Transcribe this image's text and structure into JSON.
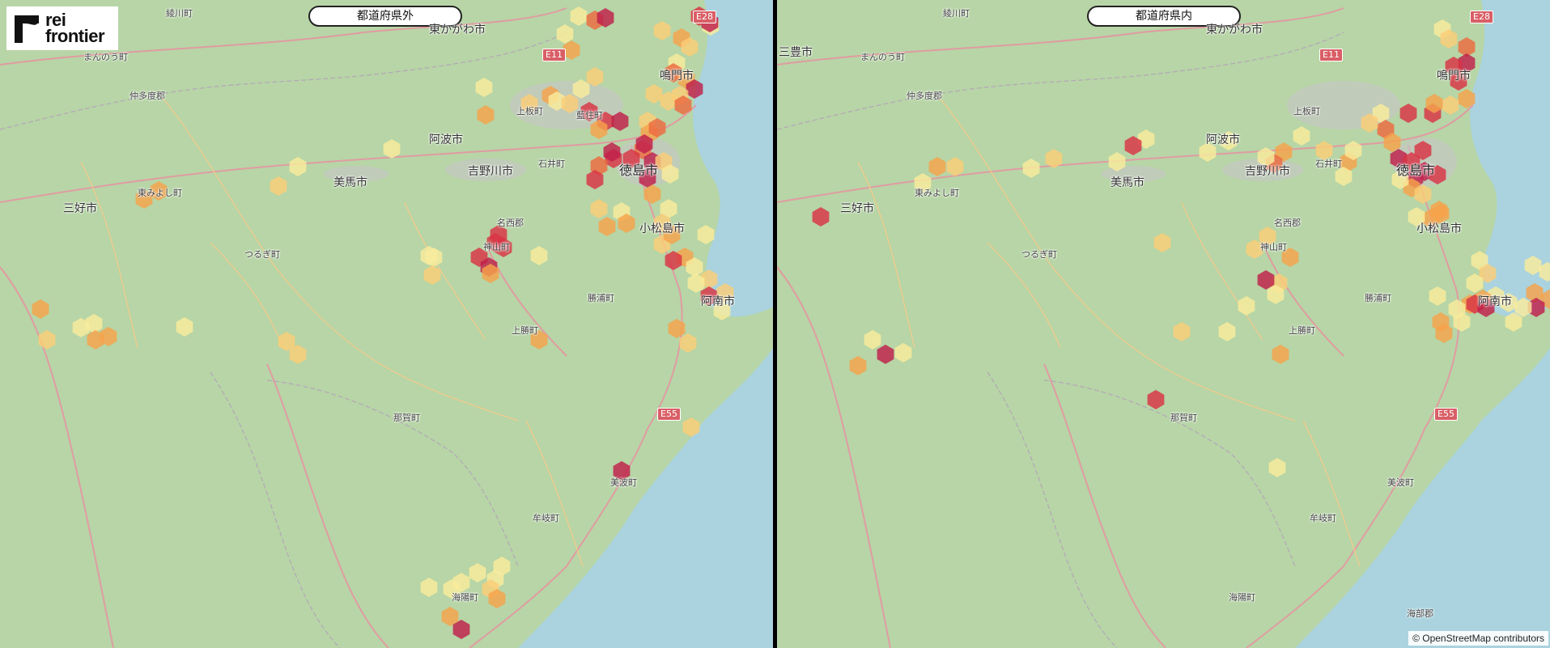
{
  "logo": {
    "line1": "rei",
    "line2": "frontier"
  },
  "attribution": "© OpenStreetMap contributors",
  "colors": {
    "water": "#aad3df",
    "land": "#b7d5a6",
    "road_major": "#e892a2",
    "road_minor": "#f7c98b",
    "bin_low": "#f9ec9c",
    "bin_mid_low": "#fbcd78",
    "bin_mid": "#f6a24b",
    "bin_mid_high": "#ed6a3f",
    "bin_high": "#d93344",
    "bin_top": "#bf1e4b"
  },
  "panels": {
    "left": {
      "title": "都道府県外",
      "labels": [
        "綾川町",
        "東かがわ市",
        "まんのう町",
        "仲多度郡",
        "鳴門市",
        "上板町",
        "藍住町",
        "阿波市",
        "吉野川市",
        "石井町",
        "徳島市",
        "美馬市",
        "東みよし町",
        "三好市",
        "つるぎ町",
        "名西郡",
        "神山町",
        "小松島市",
        "勝浦町",
        "阿南市",
        "上勝町",
        "那賀町",
        "美波町",
        "牟岐町",
        "海陽町",
        "E28",
        "E11",
        "E55"
      ],
      "hex_bins": [
        [
          715,
          20,
          "low"
        ],
        [
          735,
          25,
          "mid_high"
        ],
        [
          748,
          22,
          "top"
        ],
        [
          698,
          42,
          "low"
        ],
        [
          818,
          38,
          "mid_low"
        ],
        [
          842,
          47,
          "mid"
        ],
        [
          852,
          58,
          "mid_low"
        ],
        [
          878,
          32,
          "low"
        ],
        [
          864,
          20,
          "high"
        ],
        [
          877,
          28,
          "top"
        ],
        [
          706,
          62,
          "mid"
        ],
        [
          735,
          95,
          "mid_low"
        ],
        [
          836,
          78,
          "low"
        ],
        [
          832,
          90,
          "mid_high"
        ],
        [
          848,
          98,
          "mid"
        ],
        [
          858,
          110,
          "top"
        ],
        [
          840,
          118,
          "mid_low"
        ],
        [
          826,
          125,
          "mid_low"
        ],
        [
          844,
          130,
          "mid_high"
        ],
        [
          808,
          116,
          "mid_low"
        ],
        [
          728,
          138,
          "high"
        ],
        [
          748,
          150,
          "high"
        ],
        [
          766,
          150,
          "top"
        ],
        [
          740,
          160,
          "mid"
        ],
        [
          680,
          118,
          "mid"
        ],
        [
          688,
          125,
          "low"
        ],
        [
          654,
          128,
          "mid_low"
        ],
        [
          704,
          128,
          "mid_low"
        ],
        [
          718,
          110,
          "low"
        ],
        [
          800,
          150,
          "mid_low"
        ],
        [
          802,
          165,
          "mid"
        ],
        [
          812,
          158,
          "mid_high"
        ],
        [
          794,
          185,
          "mid_high"
        ],
        [
          780,
          196,
          "high"
        ],
        [
          758,
          196,
          "high"
        ],
        [
          740,
          205,
          "mid_high"
        ],
        [
          735,
          222,
          "high"
        ],
        [
          756,
          188,
          "top"
        ],
        [
          796,
          178,
          "top"
        ],
        [
          806,
          200,
          "top"
        ],
        [
          800,
          220,
          "top"
        ],
        [
          820,
          200,
          "mid_low"
        ],
        [
          828,
          215,
          "low"
        ],
        [
          806,
          240,
          "mid"
        ],
        [
          826,
          258,
          "low"
        ],
        [
          818,
          276,
          "mid_low"
        ],
        [
          818,
          302,
          "mid_low"
        ],
        [
          830,
          290,
          "mid"
        ],
        [
          846,
          318,
          "mid"
        ],
        [
          832,
          322,
          "high"
        ],
        [
          858,
          330,
          "low"
        ],
        [
          872,
          290,
          "low"
        ],
        [
          876,
          345,
          "mid_low"
        ],
        [
          860,
          350,
          "low"
        ],
        [
          876,
          366,
          "high"
        ],
        [
          896,
          362,
          "mid_low"
        ],
        [
          892,
          384,
          "low"
        ],
        [
          836,
          406,
          "mid"
        ],
        [
          850,
          424,
          "mid_low"
        ],
        [
          740,
          258,
          "mid_low"
        ],
        [
          768,
          262,
          "low"
        ],
        [
          774,
          276,
          "mid"
        ],
        [
          750,
          280,
          "mid"
        ],
        [
          598,
          108,
          "low"
        ],
        [
          600,
          142,
          "mid"
        ],
        [
          484,
          184,
          "low"
        ],
        [
          368,
          206,
          "low"
        ],
        [
          344,
          230,
          "mid_low"
        ],
        [
          196,
          236,
          "mid"
        ],
        [
          178,
          246,
          "mid"
        ],
        [
          536,
          318,
          "low"
        ],
        [
          534,
          340,
          "mid_low"
        ],
        [
          616,
          290,
          "high"
        ],
        [
          612,
          300,
          "high"
        ],
        [
          592,
          318,
          "high"
        ],
        [
          604,
          330,
          "top"
        ],
        [
          622,
          306,
          "high"
        ],
        [
          606,
          338,
          "mid"
        ],
        [
          666,
          316,
          "low"
        ],
        [
          530,
          316,
          "low"
        ],
        [
          50,
          382,
          "mid"
        ],
        [
          100,
          405,
          "low"
        ],
        [
          116,
          400,
          "low"
        ],
        [
          118,
          420,
          "mid"
        ],
        [
          134,
          416,
          "mid"
        ],
        [
          58,
          420,
          "mid_low"
        ],
        [
          228,
          404,
          "low"
        ],
        [
          354,
          422,
          "mid_low"
        ],
        [
          368,
          438,
          "mid_low"
        ],
        [
          666,
          420,
          "mid"
        ],
        [
          854,
          528,
          "mid_low"
        ],
        [
          768,
          582,
          "top"
        ],
        [
          620,
          700,
          "low"
        ],
        [
          612,
          716,
          "low"
        ],
        [
          590,
          708,
          "low"
        ],
        [
          570,
          720,
          "low"
        ],
        [
          558,
          728,
          "low"
        ],
        [
          530,
          726,
          "low"
        ],
        [
          606,
          728,
          "mid_low"
        ],
        [
          614,
          740,
          "mid"
        ],
        [
          556,
          762,
          "mid"
        ],
        [
          570,
          778,
          "top"
        ]
      ]
    },
    "right": {
      "title": "都道府県内",
      "labels": [
        "綾川町",
        "三豊市",
        "まんのう町",
        "仲多度郡",
        "東かがわ市",
        "鳴門市",
        "上板町",
        "阿波市",
        "吉野川市",
        "石井町",
        "徳島市",
        "美馬市",
        "東みよし町",
        "三好市",
        "つるぎ町",
        "名西郡",
        "神山町",
        "小松島市",
        "勝浦町",
        "阿南市",
        "上勝町",
        "那賀町",
        "美波町",
        "牟岐町",
        "海陽町",
        "海部郡",
        "E28",
        "E11",
        "E55"
      ],
      "hex_bins": [
        [
          822,
          36,
          "low"
        ],
        [
          830,
          48,
          "mid_low"
        ],
        [
          852,
          58,
          "mid_high"
        ],
        [
          852,
          78,
          "top"
        ],
        [
          836,
          82,
          "high"
        ],
        [
          842,
          100,
          "high"
        ],
        [
          852,
          122,
          "mid"
        ],
        [
          832,
          130,
          "mid_low"
        ],
        [
          810,
          140,
          "high"
        ],
        [
          812,
          128,
          "mid"
        ],
        [
          780,
          140,
          "high"
        ],
        [
          746,
          140,
          "low"
        ],
        [
          752,
          160,
          "mid_high"
        ],
        [
          732,
          152,
          "mid_low"
        ],
        [
          760,
          176,
          "mid"
        ],
        [
          768,
          196,
          "top"
        ],
        [
          784,
          200,
          "high"
        ],
        [
          788,
          220,
          "top"
        ],
        [
          800,
          212,
          "top"
        ],
        [
          816,
          216,
          "high"
        ],
        [
          784,
          232,
          "mid"
        ],
        [
          770,
          222,
          "low"
        ],
        [
          798,
          240,
          "mid_low"
        ],
        [
          818,
          260,
          "mid"
        ],
        [
          808,
          270,
          "mid"
        ],
        [
          790,
          268,
          "low"
        ],
        [
          798,
          186,
          "high"
        ],
        [
          706,
          200,
          "mid"
        ],
        [
          712,
          186,
          "low"
        ],
        [
          700,
          218,
          "low"
        ],
        [
          676,
          186,
          "mid_low"
        ],
        [
          648,
          168,
          "low"
        ],
        [
          626,
          188,
          "mid"
        ],
        [
          614,
          202,
          "mid_high"
        ],
        [
          604,
          194,
          "low"
        ],
        [
          558,
          174,
          "low"
        ],
        [
          532,
          188,
          "low"
        ],
        [
          456,
          172,
          "low"
        ],
        [
          440,
          180,
          "high"
        ],
        [
          420,
          200,
          "low"
        ],
        [
          342,
          196,
          "mid_low"
        ],
        [
          314,
          208,
          "low"
        ],
        [
          220,
          206,
          "mid_low"
        ],
        [
          198,
          206,
          "mid"
        ],
        [
          180,
          226,
          "low"
        ],
        [
          54,
          268,
          "high"
        ],
        [
          476,
          300,
          "mid_low"
        ],
        [
          634,
          318,
          "mid"
        ],
        [
          606,
          292,
          "mid_low"
        ],
        [
          590,
          308,
          "mid_low"
        ],
        [
          820,
          264,
          "mid"
        ],
        [
          868,
          322,
          "low"
        ],
        [
          878,
          338,
          "mid_low"
        ],
        [
          862,
          350,
          "low"
        ],
        [
          888,
          366,
          "low"
        ],
        [
          872,
          370,
          "mid"
        ],
        [
          856,
          376,
          "mid"
        ],
        [
          840,
          382,
          "low"
        ],
        [
          846,
          398,
          "low"
        ],
        [
          816,
          366,
          "low"
        ],
        [
          820,
          398,
          "mid"
        ],
        [
          824,
          412,
          "mid"
        ],
        [
          862,
          376,
          "high"
        ],
        [
          876,
          380,
          "top"
        ],
        [
          620,
          350,
          "mid_low"
        ],
        [
          616,
          364,
          "low"
        ],
        [
          604,
          346,
          "top"
        ],
        [
          580,
          378,
          "low"
        ],
        [
          556,
          410,
          "low"
        ],
        [
          500,
          410,
          "mid_low"
        ],
        [
          468,
          494,
          "high"
        ],
        [
          622,
          438,
          "mid"
        ],
        [
          934,
          328,
          "low"
        ],
        [
          952,
          336,
          "low"
        ],
        [
          936,
          362,
          "mid"
        ],
        [
          954,
          370,
          "mid"
        ],
        [
          938,
          380,
          "top"
        ],
        [
          922,
          380,
          "low"
        ],
        [
          904,
          374,
          "low"
        ],
        [
          910,
          398,
          "low"
        ],
        [
          118,
          420,
          "low"
        ],
        [
          134,
          438,
          "top"
        ],
        [
          100,
          452,
          "mid"
        ],
        [
          156,
          436,
          "low"
        ],
        [
          618,
          578,
          "low"
        ]
      ]
    }
  }
}
